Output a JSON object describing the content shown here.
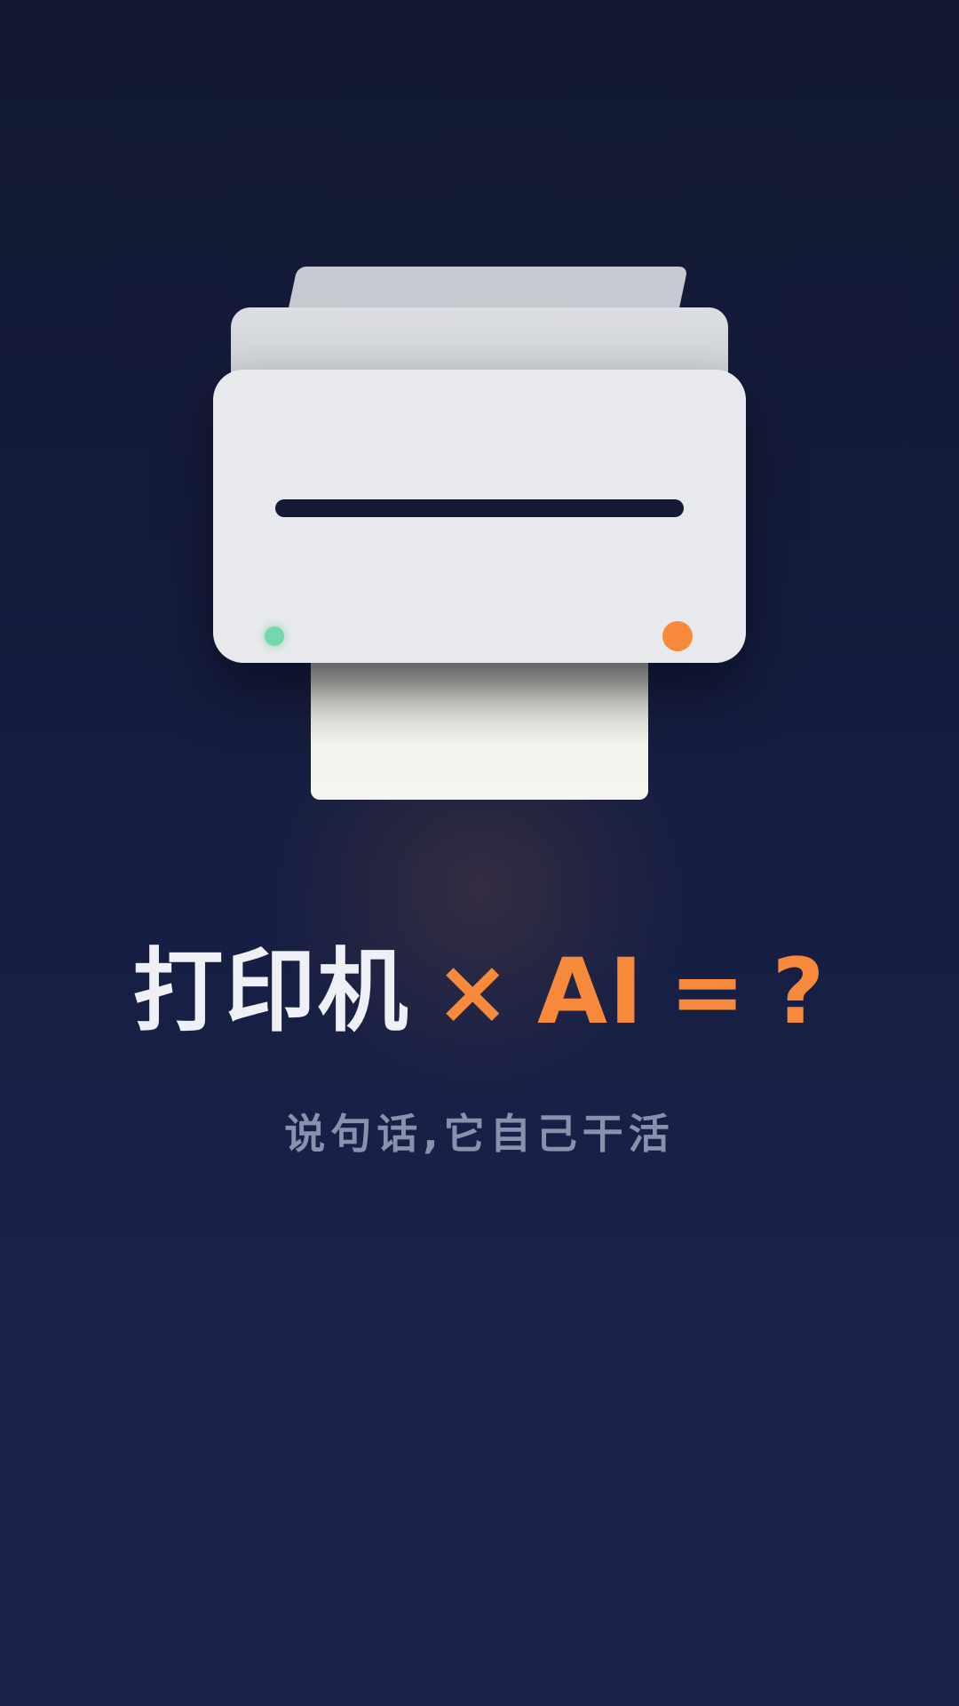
{
  "headline": {
    "part1": "打印机",
    "times": "×",
    "ai": "AI",
    "equals": "=",
    "question": "?"
  },
  "subtitle": "说句话,它自己干活",
  "colors": {
    "background": "#151d3e",
    "accent": "#f7893a",
    "printer_body": "#e8e9ec",
    "led_green": "#74d8ad",
    "headline_white": "#eef0f5",
    "subtitle": "#8792ad"
  },
  "illustration": {
    "name": "printer-illustration",
    "status_light": "green",
    "button": "orange"
  }
}
